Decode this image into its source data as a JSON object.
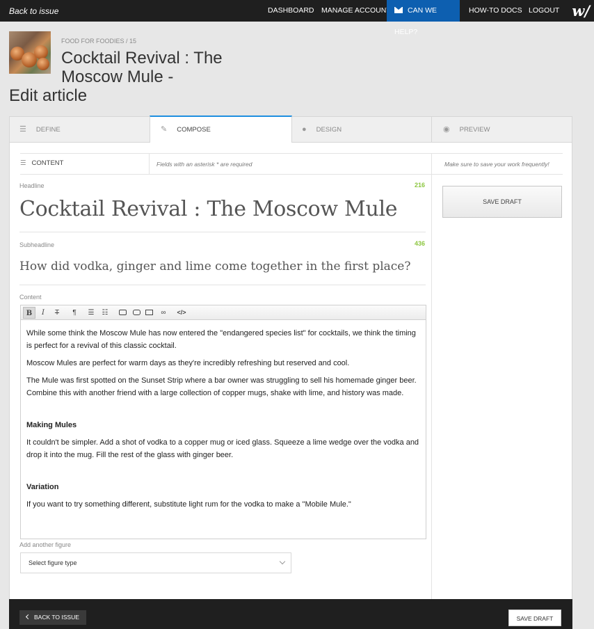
{
  "topbar": {
    "back_label": "Back to issue",
    "nav": [
      "DASHBOARD",
      "MANAGE ACCOUNT",
      "CAN WE HELP?",
      "HOW-TO DOCS",
      "LOGOUT"
    ],
    "logo": "w/"
  },
  "header": {
    "breadcrumb": "FOOD FOR FOODIES / 15",
    "title": "Cocktail Revival : The Moscow Mule -",
    "subtitle": "Edit article"
  },
  "tabs": [
    {
      "label": "DEFINE",
      "icon": "list-icon"
    },
    {
      "label": "COMPOSE",
      "icon": "pencil-icon",
      "active": true
    },
    {
      "label": "DESIGN",
      "icon": "drop-icon"
    },
    {
      "label": "PREVIEW",
      "icon": "eye-icon"
    }
  ],
  "section": {
    "content_label": "CONTENT",
    "required_note": "Fields with an asterisk * are required",
    "save_note": "Make sure to save your work frequently!"
  },
  "fields": {
    "headline_label": "Headline",
    "headline_count": "216",
    "headline_value": "Cocktail Revival : The Moscow Mule",
    "subheadline_label": "Subheadline",
    "subheadline_count": "436",
    "subheadline_value": "How did vodka, ginger and lime come together in the first place?",
    "content_label": "Content"
  },
  "toolbar": {
    "bold": "B",
    "italic": "I",
    "strike": "T",
    "paragraph": "¶",
    "code": "</>"
  },
  "content": {
    "p1": "While some think the Moscow Mule has now entered the \"endangered species list\" for cocktails, we think the timing is perfect for a revival of this classic cocktail.",
    "p2": "Moscow Mules are perfect for warm days as they're incredibly refreshing but reserved and cool.",
    "p3": "The Mule was first spotted on the Sunset Strip where a bar owner was struggling to sell his homemade ginger beer. Combine this with another friend with a large collection of copper mugs, shake with lime, and history was made.",
    "h1": "Making Mules",
    "p4": "It couldn't be simpler. Add a shot of vodka to a copper mug or iced glass. Squeeze a lime wedge over the vodka and drop it into the mug. Fill the rest of the glass with ginger beer.",
    "h2": "Variation",
    "p5": "If you want to try something different, substitute light rum for the vodka to make a \"Mobile Mule.\""
  },
  "figure": {
    "label": "Add another figure",
    "select_value": "Select figure type"
  },
  "sidebar": {
    "save_draft": "SAVE DRAFT"
  },
  "footer": {
    "back": "BACK TO ISSUE",
    "save": "SAVE DRAFT"
  },
  "colors": {
    "topbar": "#1f1f1f",
    "help_accent": "#0d5fb0",
    "count_green": "#8cc63f",
    "active_tab_border": "#1d8fe0"
  }
}
